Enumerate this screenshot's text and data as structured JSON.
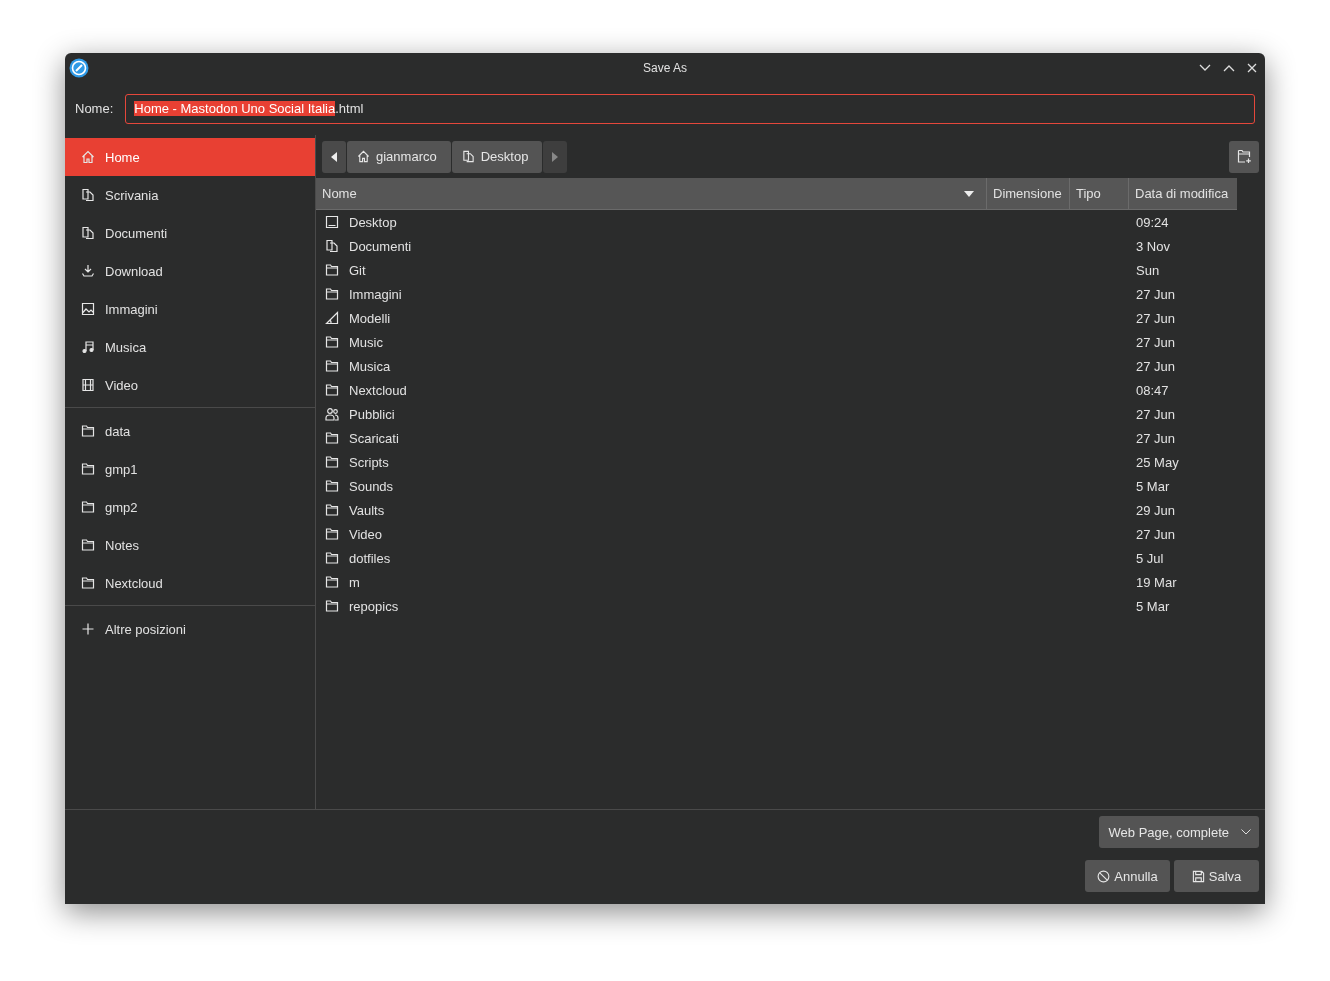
{
  "window": {
    "title": "Save As"
  },
  "name_field": {
    "label": "Nome:",
    "selected_text": "Home - Mastodon Uno Social Italia",
    "rest_text": ".html"
  },
  "sidebar": {
    "places": [
      {
        "label": "Home",
        "kind": "home",
        "selected": true
      },
      {
        "label": "Scrivania",
        "kind": "docs",
        "selected": false
      },
      {
        "label": "Documenti",
        "kind": "docs",
        "selected": false
      },
      {
        "label": "Download",
        "kind": "download",
        "selected": false
      },
      {
        "label": "Immagini",
        "kind": "image",
        "selected": false
      },
      {
        "label": "Musica",
        "kind": "music",
        "selected": false
      },
      {
        "label": "Video",
        "kind": "video",
        "selected": false
      }
    ],
    "bookmarks": [
      {
        "label": "data",
        "kind": "folder",
        "selected": false
      },
      {
        "label": "gmp1",
        "kind": "folder",
        "selected": false
      },
      {
        "label": "gmp2",
        "kind": "folder",
        "selected": false
      },
      {
        "label": "Notes",
        "kind": "folder",
        "selected": false
      },
      {
        "label": "Nextcloud",
        "kind": "folder",
        "selected": false
      }
    ],
    "other": {
      "label": "Altre posizioni",
      "kind": "plus"
    }
  },
  "path_bar": [
    {
      "label": "gianmarco",
      "kind": "home"
    },
    {
      "label": "Desktop",
      "kind": "docs"
    }
  ],
  "table": {
    "columns": [
      "Nome",
      "Dimensione",
      "Tipo",
      "Data di modifica"
    ],
    "rows": [
      {
        "name": "Desktop",
        "kind": "desktop",
        "modified": "09:24"
      },
      {
        "name": "Documenti",
        "kind": "docs",
        "modified": "3 Nov"
      },
      {
        "name": "Git",
        "kind": "folder",
        "modified": "Sun"
      },
      {
        "name": "Immagini",
        "kind": "folder",
        "modified": "27 Jun"
      },
      {
        "name": "Modelli",
        "kind": "template",
        "modified": "27 Jun"
      },
      {
        "name": "Music",
        "kind": "folder",
        "modified": "27 Jun"
      },
      {
        "name": "Musica",
        "kind": "folder",
        "modified": "27 Jun"
      },
      {
        "name": "Nextcloud",
        "kind": "folder",
        "modified": "08:47"
      },
      {
        "name": "Pubblici",
        "kind": "people",
        "modified": "27 Jun"
      },
      {
        "name": "Scaricati",
        "kind": "folder",
        "modified": "27 Jun"
      },
      {
        "name": "Scripts",
        "kind": "folder",
        "modified": "25 May"
      },
      {
        "name": "Sounds",
        "kind": "folder",
        "modified": "5 Mar"
      },
      {
        "name": "Vaults",
        "kind": "folder",
        "modified": "29 Jun"
      },
      {
        "name": "Video",
        "kind": "folder",
        "modified": "27 Jun"
      },
      {
        "name": "dotfiles",
        "kind": "folder",
        "modified": "5 Jul"
      },
      {
        "name": "m",
        "kind": "folder",
        "modified": "19 Mar"
      },
      {
        "name": "repopics",
        "kind": "folder",
        "modified": "5 Mar"
      }
    ]
  },
  "file_type": "Web Page, complete",
  "buttons": [
    {
      "label": "Annulla",
      "kind": "cancel"
    },
    {
      "label": "Salva",
      "kind": "save"
    }
  ]
}
